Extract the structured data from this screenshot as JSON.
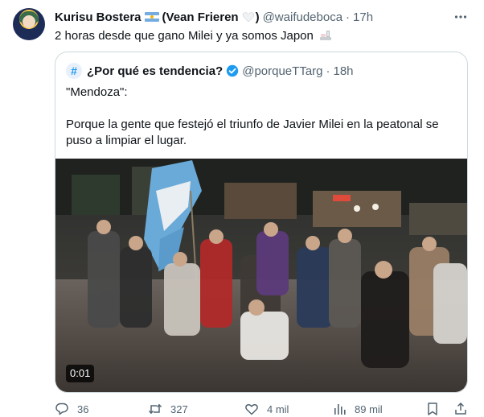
{
  "tweet": {
    "author_name": "Kurisu Bostera",
    "author_extra": "(Vean Frieren",
    "author_extra_close": ")",
    "handle": "@waifudeboca",
    "separator": "·",
    "time": "17h",
    "text": "2 horas desde que gano Milei y ya somos Japon",
    "icons": {
      "flag": "argentina-flag-icon",
      "heart": "white-heart-icon",
      "emoji": "japan-emoji-icon",
      "more": "more-options-icon"
    }
  },
  "quote": {
    "avatar_symbol": "#",
    "author_name": "¿Por qué es tendencia?",
    "handle": "@porqueTTarg",
    "separator": "·",
    "time": "18h",
    "line1": "\"Mendoza\":",
    "line2": "Porque la gente que festejó el triunfo de Javier Milei en la peatonal se puso a limpiar el lugar.",
    "video_duration": "0:01",
    "icons": {
      "verified": "verified-badge-icon"
    }
  },
  "actions": {
    "replies": "36",
    "retweets": "327",
    "likes": "4 mil",
    "views": "89 mil"
  },
  "colors": {
    "text": "#0f1419",
    "secondary": "#536471",
    "border": "#cfd9de",
    "accent": "#1d9bf0"
  }
}
